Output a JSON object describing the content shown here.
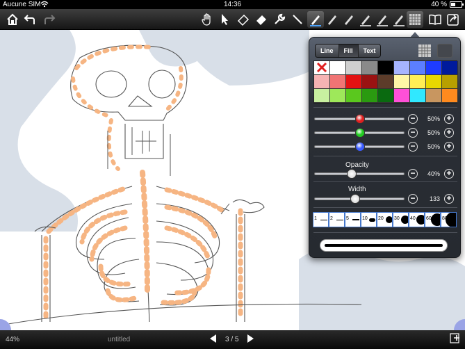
{
  "status_bar": {
    "carrier": "Aucune SIM",
    "time": "14:36",
    "battery": "40 %"
  },
  "toolbar": {
    "tools": [
      {
        "name": "home-icon"
      },
      {
        "name": "undo-icon"
      },
      {
        "name": "redo-icon"
      },
      {
        "name": "hand-icon"
      },
      {
        "name": "select-arrow-icon"
      },
      {
        "name": "eraser-icon"
      },
      {
        "name": "fill-eraser-icon"
      },
      {
        "name": "wrench-icon"
      },
      {
        "name": "line-tool-icon"
      },
      {
        "name": "pen-1-icon"
      },
      {
        "name": "pen-2-icon"
      },
      {
        "name": "pen-3-icon"
      },
      {
        "name": "pen-4-icon"
      },
      {
        "name": "pen-5-icon"
      },
      {
        "name": "pen-6-icon"
      },
      {
        "name": "pattern-icon"
      },
      {
        "name": "book-icon"
      },
      {
        "name": "share-icon"
      }
    ]
  },
  "bottom_bar": {
    "zoom": "44%",
    "document_name": "untitled",
    "page_indicator": "3 / 5"
  },
  "popover": {
    "tabs": [
      {
        "label": "Line",
        "selected": false
      },
      {
        "label": "Fill",
        "selected": true
      },
      {
        "label": "Text",
        "selected": false
      }
    ],
    "palette": [
      "none",
      "#ffffff",
      "#cfcfcf",
      "#8a8a8a",
      "#000000",
      "#a6b4ff",
      "#5c7fff",
      "#1e3cff",
      "#001a9c",
      "#f6b3b3",
      "#f07474",
      "#e31212",
      "#9a1212",
      "#5c3c2a",
      "#fff6a6",
      "#ffee55",
      "#e8d800",
      "#b8a000",
      "#c8f0a0",
      "#9ee85a",
      "#5ac81e",
      "#2a9a10",
      "#0a6a10",
      "#ff50d8",
      "#30e8ff",
      "#c89660",
      "#ff8a1e"
    ],
    "rgb_sliders": [
      {
        "color": "red",
        "value": 0.5,
        "percent": "50%"
      },
      {
        "color": "green",
        "value": 0.5,
        "percent": "50%"
      },
      {
        "color": "blue",
        "value": 0.5,
        "percent": "50%"
      }
    ],
    "opacity": {
      "label": "Opacity",
      "value": 0.4,
      "percent": "40%"
    },
    "width": {
      "label": "Width",
      "value": 0.44,
      "readout": "133"
    },
    "width_presets": [
      "1",
      "2",
      "5",
      "10",
      "20",
      "30",
      "40",
      "60",
      "80"
    ]
  },
  "colors": {
    "knob_red": "#e02020",
    "knob_green": "#22cc22",
    "knob_blue": "#3a5cff",
    "skeleton_fill": "#f6b583",
    "background_cloud": "#d8dfe8"
  }
}
